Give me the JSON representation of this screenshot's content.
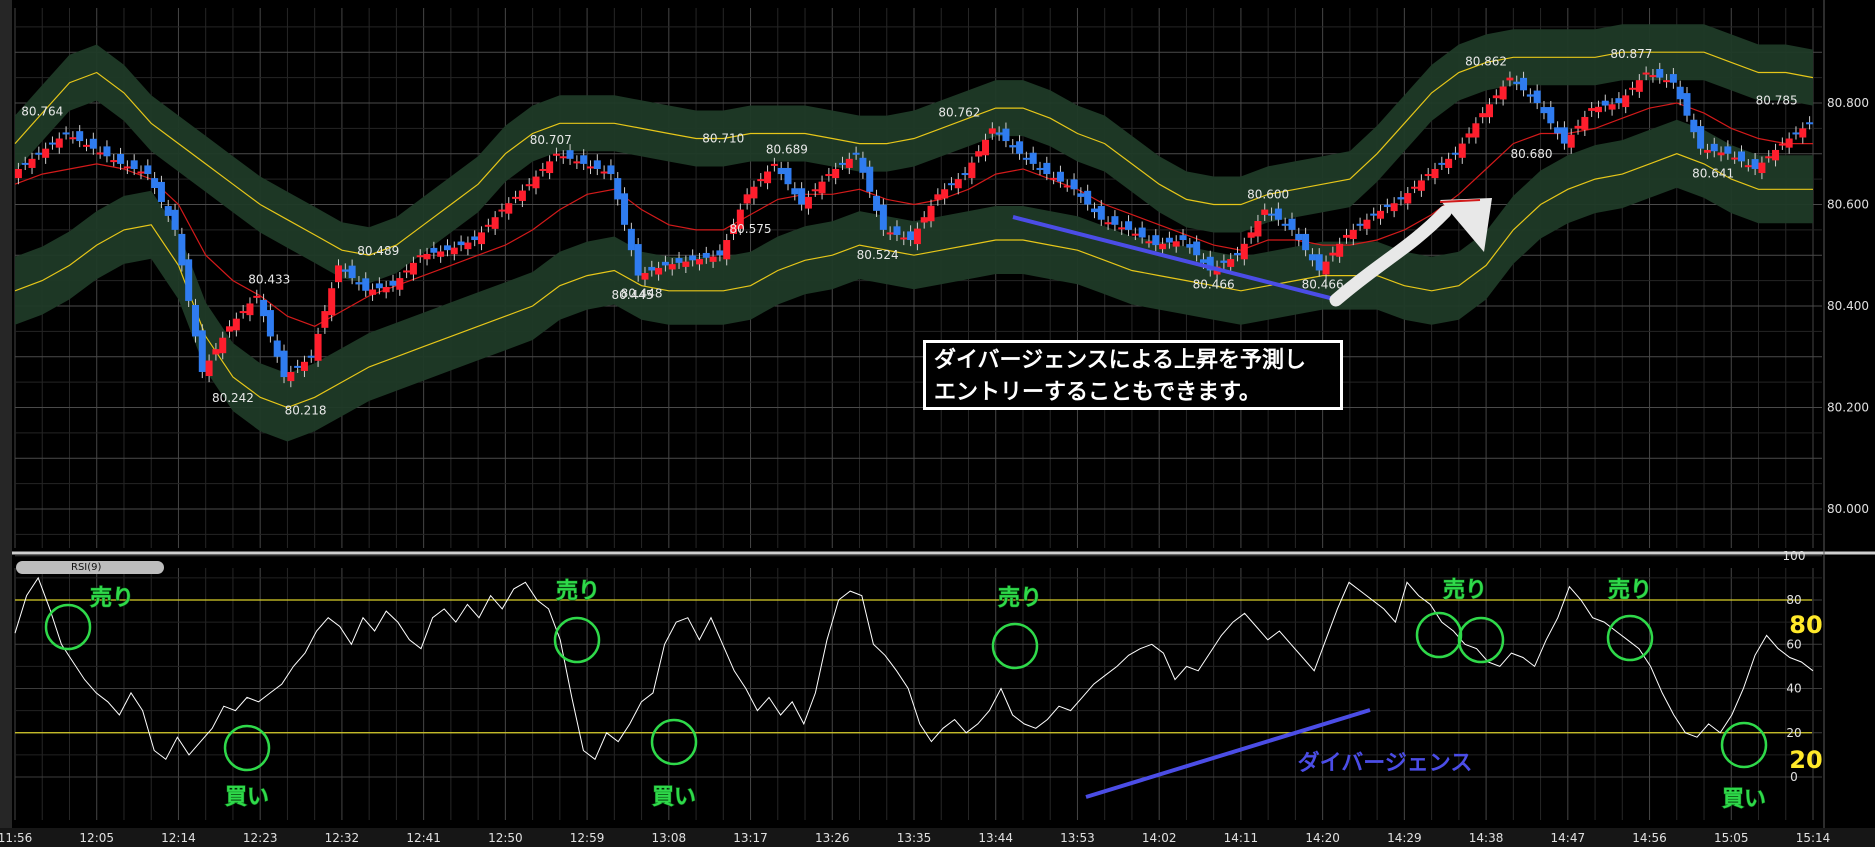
{
  "colors": {
    "background": "#000000",
    "grid": "#3a3a3a",
    "bull_candle": "#ff1e2d",
    "bear_candle": "#2f7cf0",
    "bollinger_band": "#e6c619",
    "moving_average": "#d21a1a",
    "band_zone": "#1f3a27",
    "rsi_line": "#ffffff",
    "rsi_level": "#d9cf2a",
    "annotation_green": "#2fd94a",
    "annotation_blue": "#4b4de6"
  },
  "chart_data": [
    {
      "type": "candlestick",
      "title": "",
      "yticks": [
        "80.800",
        "80.600",
        "80.400",
        "80.200",
        "80.000"
      ],
      "ylim": [
        79.86,
        80.95
      ],
      "xticks": [
        "11:56",
        "12:05",
        "12:14",
        "12:23",
        "12:32",
        "12:41",
        "12:50",
        "12:59",
        "13:08",
        "13:17",
        "13:26",
        "13:35",
        "13:44",
        "13:53",
        "14:02",
        "14:11",
        "14:20",
        "14:29",
        "14:38",
        "14:47",
        "14:56",
        "15:05",
        "15:14"
      ],
      "grid": true,
      "price_labels": [
        {
          "x": "11:59",
          "value": "80.764"
        },
        {
          "x": "12:20",
          "value": "80.242"
        },
        {
          "x": "12:24",
          "value": "80.433"
        },
        {
          "x": "12:28",
          "value": "80.218"
        },
        {
          "x": "12:36",
          "value": "80.489"
        },
        {
          "x": "12:55",
          "value": "80.707"
        },
        {
          "x": "13:05",
          "value": "80.448"
        },
        {
          "x": "13:04",
          "value": "80.445"
        },
        {
          "x": "13:14",
          "value": "80.710"
        },
        {
          "x": "13:17",
          "value": "80.575"
        },
        {
          "x": "13:21",
          "value": "80.689"
        },
        {
          "x": "13:31",
          "value": "80.524"
        },
        {
          "x": "13:40",
          "value": "80.762"
        },
        {
          "x": "14:08",
          "value": "80.466"
        },
        {
          "x": "14:14",
          "value": "80.600"
        },
        {
          "x": "14:20",
          "value": "80.466"
        },
        {
          "x": "14:38",
          "value": "80.862"
        },
        {
          "x": "14:43",
          "value": "80.680"
        },
        {
          "x": "14:54",
          "value": "80.877"
        },
        {
          "x": "15:03",
          "value": "80.641"
        },
        {
          "x": "15:10",
          "value": "80.785"
        }
      ],
      "series": [
        {
          "name": "",
          "kind": "close",
          "x": [
            "11:56",
            "11:59",
            "12:02",
            "12:05",
            "12:08",
            "12:11",
            "12:14",
            "12:17",
            "12:20",
            "12:23",
            "12:26",
            "12:29",
            "12:32",
            "12:35",
            "12:38",
            "12:41",
            "12:44",
            "12:47",
            "12:50",
            "12:53",
            "12:56",
            "12:59",
            "13:02",
            "13:05",
            "13:08",
            "13:11",
            "13:14",
            "13:17",
            "13:20",
            "13:23",
            "13:26",
            "13:29",
            "13:32",
            "13:35",
            "13:38",
            "13:41",
            "13:44",
            "13:47",
            "13:50",
            "13:53",
            "13:56",
            "13:59",
            "14:02",
            "14:05",
            "14:08",
            "14:11",
            "14:14",
            "14:17",
            "14:20",
            "14:23",
            "14:26",
            "14:29",
            "14:32",
            "14:35",
            "14:38",
            "14:41",
            "14:44",
            "14:47",
            "14:50",
            "14:53",
            "14:56",
            "14:59",
            "15:02",
            "15:05",
            "15:08",
            "15:11",
            "15:14"
          ],
          "values": [
            80.66,
            80.7,
            80.74,
            80.71,
            80.68,
            80.66,
            80.55,
            80.27,
            80.36,
            80.42,
            80.26,
            80.3,
            80.48,
            80.43,
            80.44,
            80.5,
            80.51,
            80.53,
            80.59,
            80.64,
            80.7,
            80.68,
            80.66,
            80.46,
            80.48,
            80.49,
            80.5,
            80.62,
            80.68,
            80.6,
            80.66,
            80.7,
            80.55,
            80.53,
            80.62,
            80.66,
            80.75,
            80.7,
            80.66,
            80.63,
            80.57,
            80.55,
            80.52,
            80.53,
            80.47,
            80.5,
            80.59,
            80.55,
            80.47,
            80.54,
            80.58,
            80.61,
            80.66,
            80.7,
            80.78,
            80.85,
            80.8,
            80.72,
            80.79,
            80.8,
            80.86,
            80.84,
            80.71,
            80.7,
            80.67,
            80.72,
            80.76
          ]
        },
        {
          "name": "",
          "kind": "moving_average",
          "values": [
            80.64,
            80.66,
            80.67,
            80.68,
            80.67,
            80.65,
            80.6,
            80.5,
            80.45,
            80.42,
            80.38,
            80.36,
            80.39,
            80.42,
            80.44,
            80.46,
            80.48,
            80.5,
            80.52,
            80.55,
            80.59,
            80.62,
            80.63,
            80.59,
            80.56,
            80.55,
            80.55,
            80.58,
            80.61,
            80.62,
            80.62,
            80.63,
            80.61,
            80.6,
            80.61,
            80.63,
            80.66,
            80.67,
            80.65,
            80.63,
            80.6,
            80.58,
            80.56,
            80.54,
            80.52,
            80.51,
            80.53,
            80.53,
            80.52,
            80.52,
            80.53,
            80.55,
            80.58,
            80.62,
            80.67,
            80.72,
            80.74,
            80.74,
            80.75,
            80.77,
            80.79,
            80.8,
            80.78,
            80.75,
            80.73,
            80.72,
            80.72
          ]
        },
        {
          "name": "",
          "kind": "bollinger_upper",
          "values": [
            80.72,
            80.78,
            80.84,
            80.86,
            80.82,
            80.76,
            80.72,
            80.68,
            80.64,
            80.6,
            80.57,
            80.54,
            80.51,
            80.5,
            80.52,
            80.56,
            80.6,
            80.64,
            80.7,
            80.74,
            80.76,
            80.76,
            80.76,
            80.75,
            80.74,
            80.73,
            80.73,
            80.74,
            80.74,
            80.74,
            80.73,
            80.72,
            80.72,
            80.73,
            80.75,
            80.77,
            80.79,
            80.79,
            80.77,
            80.74,
            80.72,
            80.68,
            80.64,
            80.61,
            80.6,
            80.6,
            80.62,
            80.63,
            80.64,
            80.65,
            80.7,
            80.76,
            80.82,
            80.86,
            80.88,
            80.89,
            80.89,
            80.89,
            80.89,
            80.9,
            80.9,
            80.9,
            80.9,
            80.88,
            80.86,
            80.86,
            80.85
          ]
        },
        {
          "name": "",
          "kind": "bollinger_lower",
          "values": [
            80.43,
            80.45,
            80.48,
            80.52,
            80.55,
            80.56,
            80.48,
            80.34,
            80.26,
            80.22,
            80.2,
            80.22,
            80.25,
            80.28,
            80.3,
            80.32,
            80.34,
            80.36,
            80.38,
            80.4,
            80.44,
            80.46,
            80.47,
            80.44,
            80.43,
            80.43,
            80.43,
            80.44,
            80.47,
            80.49,
            80.5,
            80.52,
            80.51,
            80.5,
            80.51,
            80.52,
            80.53,
            80.53,
            80.52,
            80.51,
            80.49,
            80.47,
            80.46,
            80.45,
            80.44,
            80.43,
            80.44,
            80.45,
            80.46,
            80.46,
            80.46,
            80.44,
            80.43,
            80.44,
            80.48,
            80.55,
            80.6,
            80.63,
            80.65,
            80.66,
            80.68,
            80.7,
            80.68,
            80.65,
            80.63,
            80.63,
            80.63
          ]
        }
      ]
    },
    {
      "type": "line",
      "title": "RSI(9)",
      "yticks": [
        "100",
        "80",
        "60",
        "40",
        "20",
        "0"
      ],
      "ylim": [
        -8,
        108
      ],
      "levels": [
        80,
        20
      ],
      "level_labels": [
        "80",
        "20"
      ],
      "series": [
        {
          "name": "RSI(9)",
          "values": [
            65,
            82,
            90,
            76,
            60,
            52,
            44,
            38,
            34,
            28,
            38,
            30,
            12,
            8,
            18,
            10,
            16,
            22,
            32,
            30,
            36,
            34,
            38,
            42,
            50,
            56,
            66,
            72,
            68,
            60,
            72,
            66,
            75,
            70,
            62,
            58,
            72,
            76,
            70,
            78,
            72,
            82,
            76,
            85,
            88,
            80,
            76,
            62,
            36,
            12,
            8,
            20,
            16,
            24,
            34,
            38,
            60,
            70,
            72,
            62,
            72,
            60,
            48,
            40,
            30,
            36,
            28,
            34,
            24,
            38,
            62,
            80,
            84,
            82,
            60,
            55,
            48,
            40,
            24,
            16,
            22,
            26,
            20,
            24,
            30,
            40,
            28,
            24,
            22,
            26,
            32,
            30,
            36,
            42,
            46,
            50,
            55,
            58,
            60,
            56,
            44,
            50,
            48,
            56,
            64,
            70,
            74,
            68,
            62,
            66,
            60,
            54,
            48,
            62,
            76,
            88,
            84,
            80,
            76,
            70,
            88,
            82,
            78,
            70,
            66,
            60,
            58,
            52,
            50,
            56,
            54,
            50,
            62,
            72,
            86,
            80,
            72,
            70,
            66,
            62,
            58,
            50,
            38,
            28,
            20,
            18,
            24,
            20,
            28,
            40,
            55,
            64,
            58,
            54,
            52,
            48
          ]
        }
      ]
    }
  ],
  "annotations": {
    "sell_label": "売り",
    "buy_label": "買い",
    "divergence_label": "ダイバージェンス",
    "level_80": "80",
    "level_20": "20",
    "callout_line1": "ダイバージェンスによる上昇を予測し",
    "callout_line2": "エントリーすることもできます。"
  },
  "rsi_badge": "RSI(9)"
}
